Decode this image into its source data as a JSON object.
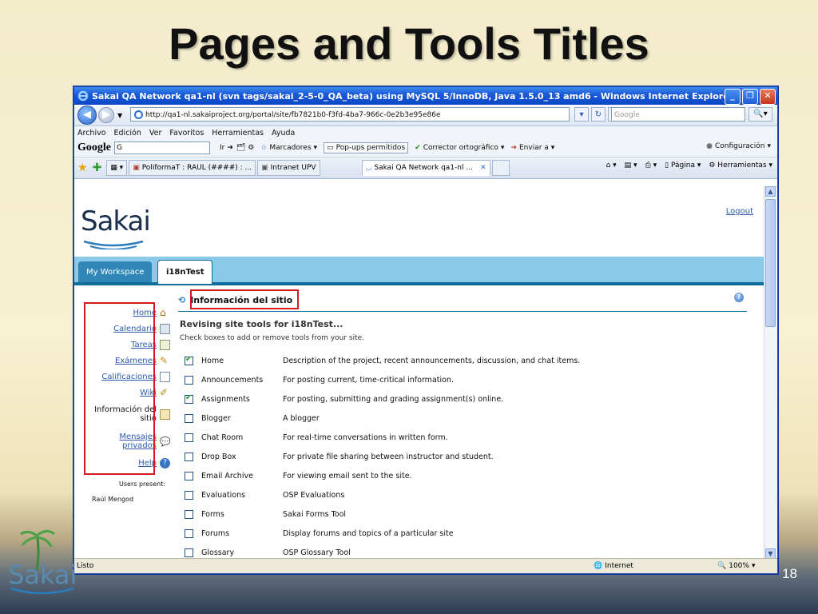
{
  "slide": {
    "title": "Pages and Tools Titles",
    "page_number": "18",
    "logo_text": "Sakai"
  },
  "browser": {
    "window_title": "Sakai QA Network qa1-nl (svn tags/sakai_2-5-0_QA_beta) using MySQL 5/InnoDB, Java 1.5.0_13 amd6 - Windows Internet Explorer",
    "address": "http://qa1-nl.sakaiproject.org/portal/site/fb7821b0-f3fd-4ba7-966c-0e2b3e95e86e",
    "search_placeholder": "Google",
    "menu": [
      "Archivo",
      "Edición",
      "Ver",
      "Favoritos",
      "Herramientas",
      "Ayuda"
    ],
    "google_bar": {
      "logo": "Google",
      "search_value": "G",
      "go": "Ir",
      "bookmarks": "Marcadores",
      "popups": "Pop-ups permitidos",
      "spell": "Corrector ortográfico",
      "send": "Enviar a",
      "config": "Configuración"
    },
    "tabs": [
      {
        "label": "PoliformaT : RAUL (####) : ...",
        "active": false
      },
      {
        "label": "Intranet UPV",
        "active": false
      },
      {
        "label": "Sakai QA Network qa1-nl ...",
        "active": true
      }
    ],
    "tab_tools": {
      "page": "Página",
      "tools": "Herramientas"
    },
    "status": {
      "left": "Listo",
      "zone": "Internet",
      "zoom": "100%"
    }
  },
  "sakai": {
    "logo": "Sakai",
    "logout": "Logout",
    "site_tabs": [
      "My Workspace",
      "i18nTest"
    ],
    "nav": [
      {
        "label": "Home",
        "link": true,
        "icon": "home-icon"
      },
      {
        "label": "Calendario",
        "link": true,
        "icon": "calendar-icon"
      },
      {
        "label": "Tareas",
        "link": true,
        "icon": "assignment-icon"
      },
      {
        "label": "Exámenes",
        "link": true,
        "icon": "pencil-icon"
      },
      {
        "label": "Calificaciones",
        "link": true,
        "icon": "gradebook-icon"
      },
      {
        "label": "Wiki",
        "link": true,
        "icon": "wiki-icon"
      },
      {
        "label": "Información del sitio",
        "link": false,
        "icon": "siteinfo-icon"
      },
      {
        "label": "Mensajes privados",
        "link": true,
        "icon": "messages-icon"
      },
      {
        "label": "Help",
        "link": true,
        "icon": "help-icon"
      }
    ],
    "users_present": "Users present:",
    "user": "Raúl Mengod",
    "tool_title": "Información del sitio",
    "revising": "Revising site tools for i18nTest...",
    "instructions": "Check boxes to add or remove tools from your site.",
    "tools": [
      {
        "name": "Home",
        "desc": "Description of the project, recent announcements, discussion, and chat items.",
        "checked": true
      },
      {
        "name": "Announcements",
        "desc": "For posting current, time-critical information.",
        "checked": false
      },
      {
        "name": "Assignments",
        "desc": "For posting, submitting and grading assignment(s) online.",
        "checked": true
      },
      {
        "name": "Blogger",
        "desc": "A blogger",
        "checked": false
      },
      {
        "name": "Chat Room",
        "desc": "For real-time conversations in written form.",
        "checked": false
      },
      {
        "name": "Drop Box",
        "desc": "For private file sharing between instructor and student.",
        "checked": false
      },
      {
        "name": "Email Archive",
        "desc": "For viewing email sent to the site.",
        "checked": false
      },
      {
        "name": "Evaluations",
        "desc": "OSP Evaluations",
        "checked": false
      },
      {
        "name": "Forms",
        "desc": "Sakai Forms Tool",
        "checked": false
      },
      {
        "name": "Forums",
        "desc": "Display forums and topics of a particular site",
        "checked": false
      },
      {
        "name": "Glossary",
        "desc": "OSP Glossary Tool",
        "checked": false
      }
    ]
  },
  "colors": {
    "highlight_box": "#d21b1b",
    "site_band": "#8bc9e8",
    "tab_active_border": "#0e6d9b",
    "link": "#2c5aa8"
  }
}
